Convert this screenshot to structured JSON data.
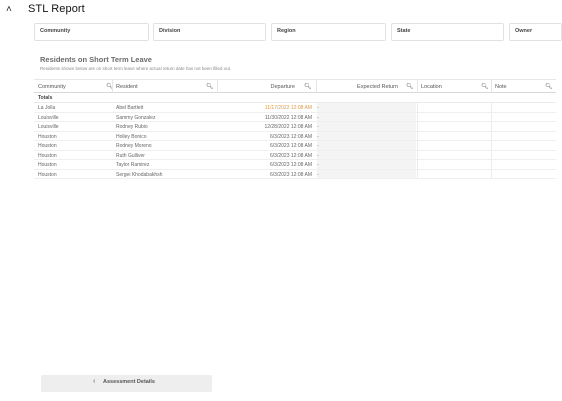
{
  "header": {
    "title": "STL Report",
    "back_icon": "back-arrow-icon"
  },
  "filters": [
    {
      "label": "Community"
    },
    {
      "label": "Division"
    },
    {
      "label": "Region"
    },
    {
      "label": "State"
    },
    {
      "label": "Owner"
    }
  ],
  "section": {
    "title": "Residents on Short Term Leave",
    "subtitle": "Residents shown below are on short term leave where actual return date has not been filled out."
  },
  "table": {
    "columns": [
      "Community",
      "Resident",
      "Departure",
      "Expected Return",
      "Location",
      "Note"
    ],
    "totals_label": "Totals",
    "rows": [
      {
        "community": "La Jolla",
        "resident": "Abel Bartlett",
        "departure": "11/17/2022 12:08 AM",
        "expected_return": "-",
        "highlight": true
      },
      {
        "community": "Louisville",
        "resident": "Sammy Gonzalez",
        "departure": "11/30/2022 12:08 AM",
        "expected_return": "-",
        "highlight": false
      },
      {
        "community": "Louisville",
        "resident": "Rodney Rubio",
        "departure": "12/28/2022 12:08 AM",
        "expected_return": "-",
        "highlight": false
      },
      {
        "community": "Houston",
        "resident": "Holley Bonico",
        "departure": "6/3/2023 12:08 AM",
        "expected_return": "-",
        "highlight": false
      },
      {
        "community": "Houston",
        "resident": "Rodney Moreno",
        "departure": "6/3/2023 12:08 AM",
        "expected_return": "-",
        "highlight": false
      },
      {
        "community": "Houston",
        "resident": "Ruth Gulliver",
        "departure": "6/3/2023 12:08 AM",
        "expected_return": "-",
        "highlight": false
      },
      {
        "community": "Houston",
        "resident": "Taylor Ramirez",
        "departure": "6/3/2023 12:08 AM",
        "expected_return": "-",
        "highlight": false
      },
      {
        "community": "Houston",
        "resident": "Sergei Khodabakhsh",
        "departure": "6/3/2023 12:08 AM",
        "expected_return": "-",
        "highlight": false
      }
    ]
  },
  "footer": {
    "button_label": "Assessment Details",
    "icon": "chevron-left-icon"
  }
}
